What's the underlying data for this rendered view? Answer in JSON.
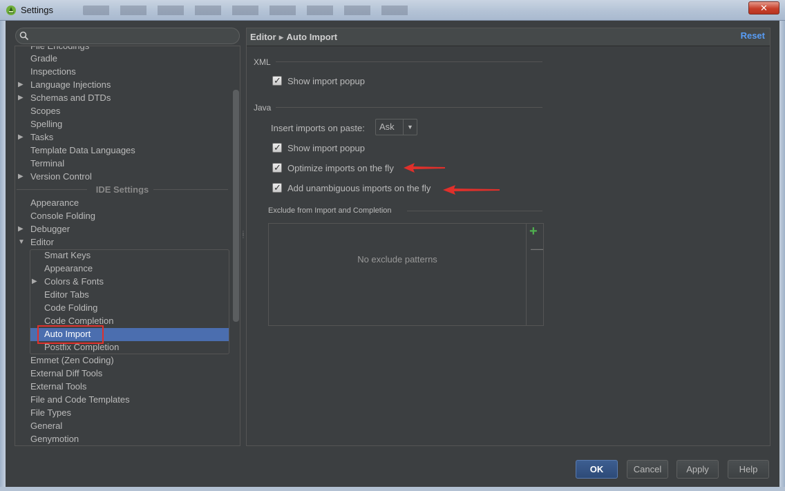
{
  "window": {
    "title": "Settings",
    "close_label": "✕"
  },
  "search": {
    "placeholder": ""
  },
  "tree": {
    "items": [
      {
        "label": "File Encodings",
        "expandable": false
      },
      {
        "label": "Gradle",
        "expandable": false
      },
      {
        "label": "Inspections",
        "expandable": false
      },
      {
        "label": "Language Injections",
        "expandable": true
      },
      {
        "label": "Schemas and DTDs",
        "expandable": true
      },
      {
        "label": "Scopes",
        "expandable": false
      },
      {
        "label": "Spelling",
        "expandable": false
      },
      {
        "label": "Tasks",
        "expandable": true
      },
      {
        "label": "Template Data Languages",
        "expandable": false
      },
      {
        "label": "Terminal",
        "expandable": false
      },
      {
        "label": "Version Control",
        "expandable": true
      }
    ],
    "section_label": "IDE Settings",
    "ide_items": [
      {
        "label": "Appearance",
        "expandable": false
      },
      {
        "label": "Console Folding",
        "expandable": false
      },
      {
        "label": "Debugger",
        "expandable": true
      },
      {
        "label": "Editor",
        "expandable": true,
        "expanded": true
      }
    ],
    "editor_children": [
      {
        "label": "Smart Keys"
      },
      {
        "label": "Appearance"
      },
      {
        "label": "Colors & Fonts",
        "expandable": true
      },
      {
        "label": "Editor Tabs"
      },
      {
        "label": "Code Folding"
      },
      {
        "label": "Code Completion"
      },
      {
        "label": "Auto Import",
        "selected": true
      },
      {
        "label": "Postfix Completion"
      }
    ],
    "after_items": [
      {
        "label": "Emmet (Zen Coding)"
      },
      {
        "label": "External Diff Tools"
      },
      {
        "label": "External Tools"
      },
      {
        "label": "File and Code Templates"
      },
      {
        "label": "File Types"
      },
      {
        "label": "General"
      },
      {
        "label": "Genymotion"
      }
    ]
  },
  "panel": {
    "breadcrumb_parent": "Editor",
    "breadcrumb_current": "Auto Import",
    "reset_label": "Reset",
    "xml": {
      "title": "XML",
      "show_import_popup": "Show import popup",
      "show_import_popup_checked": true
    },
    "java": {
      "title": "Java",
      "insert_imports_label": "Insert imports on paste:",
      "insert_imports_value": "Ask",
      "show_import_popup": "Show import popup",
      "show_import_popup_checked": true,
      "optimize_imports": "Optimize imports on the fly",
      "optimize_imports_checked": true,
      "add_unambiguous": "Add unambiguous imports on the fly",
      "add_unambiguous_checked": true
    },
    "exclude": {
      "title": "Exclude from Import and Completion",
      "empty_text": "No exclude patterns"
    }
  },
  "buttons": {
    "ok": "OK",
    "cancel": "Cancel",
    "apply": "Apply",
    "help": "Help"
  },
  "colors": {
    "selection": "#4b6eaf",
    "annotation_red": "#e0302b",
    "link": "#589df6",
    "background": "#3c3f41"
  }
}
